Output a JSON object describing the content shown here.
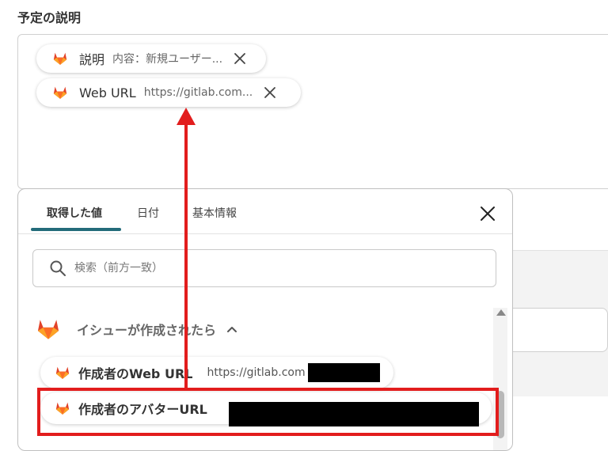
{
  "section": {
    "label": "予定の説明"
  },
  "chips": [
    {
      "name": "説明",
      "value": "内容：新規ユーザー..."
    },
    {
      "name": "Web URL",
      "value": "https://gitlab.com..."
    }
  ],
  "popup": {
    "tabs": [
      {
        "label": "取得した値"
      },
      {
        "label": "日付"
      },
      {
        "label": "基本情報"
      }
    ],
    "search": {
      "placeholder": "検索（前方一致）"
    },
    "group": {
      "label": "イシューが作成されたら"
    },
    "items": [
      {
        "name": "作成者のWeb URL",
        "value": "https://gitlab.com"
      },
      {
        "name": "作成者のアバターURL",
        "value": ""
      }
    ]
  },
  "colors": {
    "accent": "#236b7a",
    "highlight": "#e21d1d",
    "gitlab_orange": "#e24329",
    "gitlab_light": "#fca326"
  },
  "icons": [
    "gitlab-icon",
    "close-icon",
    "search-icon",
    "chevron-up-icon"
  ]
}
